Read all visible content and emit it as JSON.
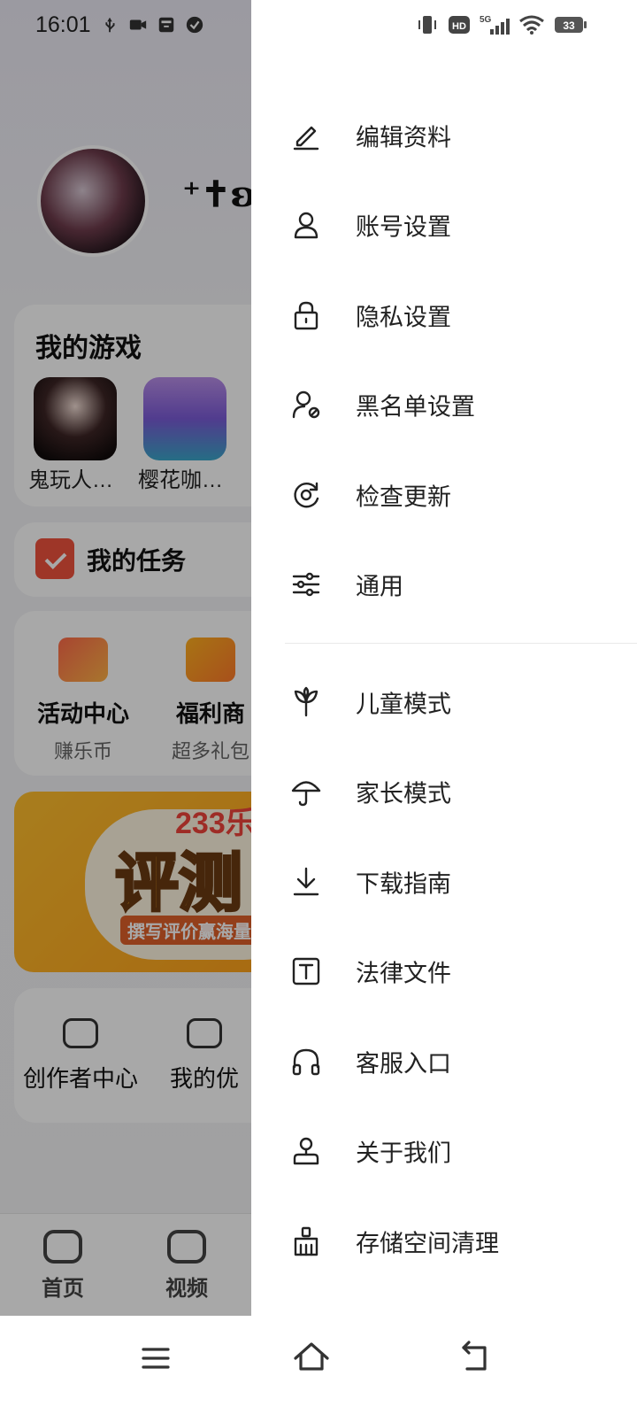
{
  "status_bar": {
    "time": "16:01",
    "battery": "33",
    "network": "5G",
    "hd": "HD"
  },
  "profile": {
    "nickname": "⁺✝ʚ"
  },
  "my_games": {
    "title": "我的游戏",
    "games": [
      {
        "label": "鬼玩人…"
      },
      {
        "label": "樱花咖…"
      }
    ]
  },
  "my_tasks": {
    "label": "我的任务"
  },
  "activities": [
    {
      "name": "活动中心",
      "sub": "赚乐币"
    },
    {
      "name": "福利商",
      "sub": "超多礼包"
    }
  ],
  "banner": {
    "brand": "233乐",
    "headline": "评测",
    "sub": "撰写评价赢海量"
  },
  "creator": [
    {
      "name": "创作者中心"
    },
    {
      "name": "我的优"
    }
  ],
  "bottom_tabs": [
    {
      "label": "首页",
      "icon": "gamepad-icon"
    },
    {
      "label": "视频",
      "icon": "tv-icon"
    }
  ],
  "drawer": {
    "group1": [
      {
        "label": "编辑资料",
        "icon": "edit-icon"
      },
      {
        "label": "账号设置",
        "icon": "user-icon"
      },
      {
        "label": "隐私设置",
        "icon": "lock-icon"
      },
      {
        "label": "黑名单设置",
        "icon": "user-block-icon"
      },
      {
        "label": "检查更新",
        "icon": "refresh-icon"
      },
      {
        "label": "通用",
        "icon": "sliders-icon"
      }
    ],
    "group2": [
      {
        "label": "儿童模式",
        "icon": "sprout-icon"
      },
      {
        "label": "家长模式",
        "icon": "umbrella-icon"
      },
      {
        "label": "下载指南",
        "icon": "download-icon"
      },
      {
        "label": "法律文件",
        "icon": "text-doc-icon"
      },
      {
        "label": "客服入口",
        "icon": "headphones-icon"
      },
      {
        "label": "关于我们",
        "icon": "stamp-icon"
      },
      {
        "label": "存储空间清理",
        "icon": "broom-icon"
      }
    ]
  },
  "system_nav": {
    "icons": [
      "menu-icon",
      "home-icon",
      "back-icon"
    ]
  },
  "colors": {
    "accent_red": "#f0523e",
    "banner_orange": "#ffa11a",
    "icon_stroke": "#222222"
  }
}
